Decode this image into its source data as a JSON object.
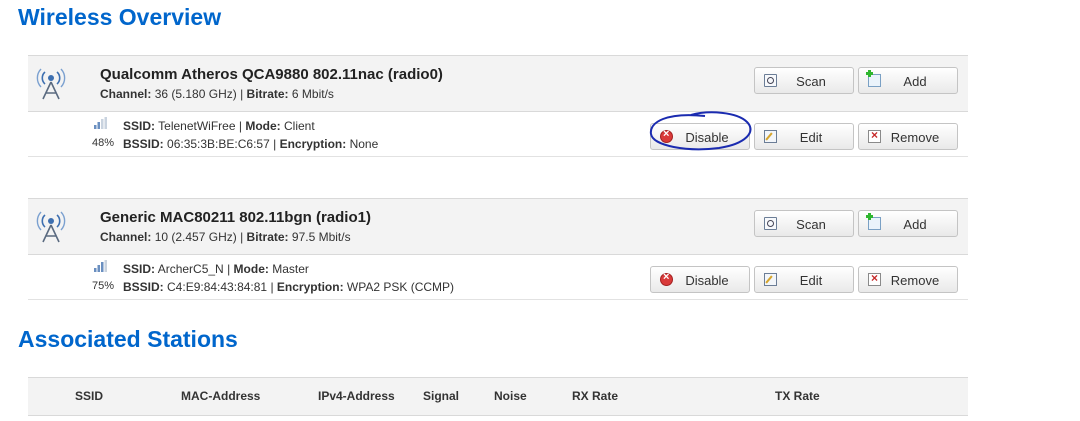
{
  "headings": {
    "wireless_overview": "Wireless Overview",
    "associated_stations": "Associated Stations"
  },
  "labels": {
    "channel": "Channel:",
    "bitrate": "Bitrate:",
    "ssid": "SSID:",
    "mode": "Mode:",
    "bssid": "BSSID:",
    "encryption": "Encryption:",
    "separator": "|"
  },
  "buttons": {
    "scan": "Scan",
    "add": "Add",
    "disable": "Disable",
    "edit": "Edit",
    "remove": "Remove"
  },
  "radios": [
    {
      "title": "Qualcomm Atheros QCA9880 802.11nac (radio0)",
      "channel": "36 (5.180 GHz)",
      "bitrate": "6 Mbit/s",
      "network": {
        "signal_percent": "48%",
        "ssid": "TelenetWiFree",
        "mode": "Client",
        "bssid": "06:35:3B:BE:C6:57",
        "encryption": "None"
      }
    },
    {
      "title": "Generic MAC80211 802.11bgn (radio1)",
      "channel": "10 (2.457 GHz)",
      "bitrate": "97.5 Mbit/s",
      "network": {
        "signal_percent": "75%",
        "ssid": "ArcherC5_N",
        "mode": "Master",
        "bssid": "C4:E9:84:43:84:81",
        "encryption": "WPA2 PSK (CCMP)"
      }
    }
  ],
  "stations_table": {
    "columns": [
      "SSID",
      "MAC-Address",
      "IPv4-Address",
      "Signal",
      "Noise",
      "RX Rate",
      "TX Rate"
    ]
  },
  "icons": {
    "radio": "wireless-radio-icon",
    "signal": "signal-strength-icon",
    "scan": "scan-icon",
    "add": "add-icon",
    "disable": "disable-icon",
    "edit": "edit-icon",
    "remove": "remove-icon"
  },
  "colors": {
    "heading": "#0066cc",
    "annotation": "#1a2bb0",
    "disable_icon": "#d93a3a"
  }
}
